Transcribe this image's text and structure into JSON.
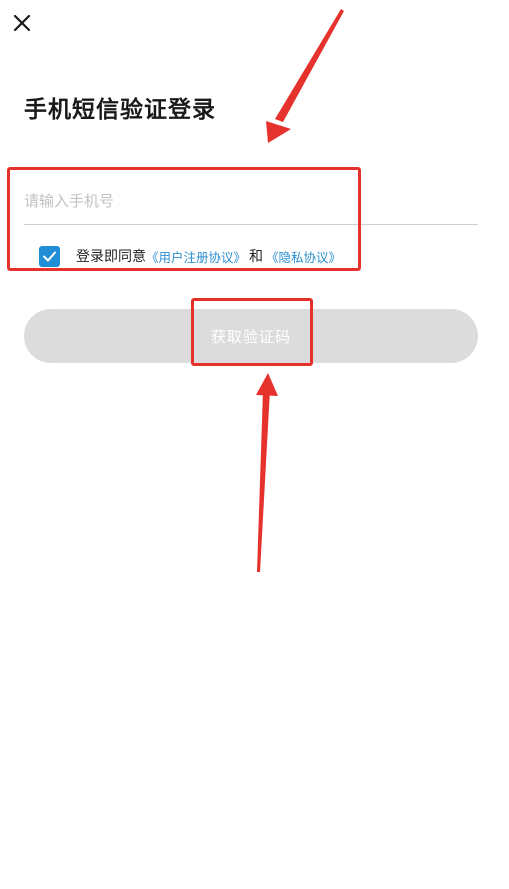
{
  "header": {
    "close_icon": "close-icon"
  },
  "page": {
    "title": "手机短信验证登录"
  },
  "phone": {
    "placeholder": "请输入手机号",
    "value": ""
  },
  "agreement": {
    "checked": true,
    "prefix": "登录即同意",
    "user_agreement": "《用户注册协议》",
    "conjunction": "和",
    "privacy_agreement": "《隐私协议》"
  },
  "actions": {
    "get_code_label": "获取验证码"
  },
  "colors": {
    "accent": "#1f8ed6",
    "link": "#2a8fd0",
    "button_disabled": "#dcdcdc",
    "annotation": "#e5322d"
  }
}
